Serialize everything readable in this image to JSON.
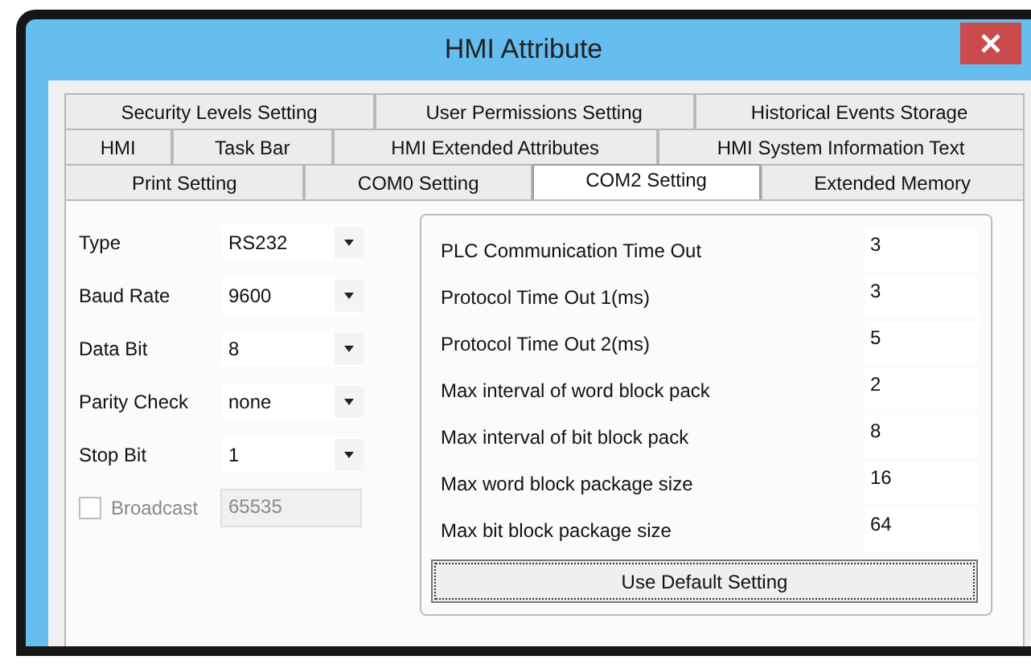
{
  "window": {
    "title": "HMI Attribute"
  },
  "tab_rows": [
    [
      {
        "label": "Security Levels Setting",
        "selected": false
      },
      {
        "label": "User Permissions Setting",
        "selected": false
      },
      {
        "label": "Historical Events Storage",
        "selected": false
      }
    ],
    [
      {
        "label": "HMI",
        "selected": false
      },
      {
        "label": "Task Bar",
        "selected": false
      },
      {
        "label": "HMI Extended Attributes",
        "selected": false
      },
      {
        "label": "HMI System Information Text",
        "selected": false
      }
    ],
    [
      {
        "label": "Print Setting",
        "selected": false
      },
      {
        "label": "COM0 Setting",
        "selected": false
      },
      {
        "label": "COM2 Setting",
        "selected": true
      },
      {
        "label": "Extended Memory",
        "selected": false
      }
    ]
  ],
  "port_settings": [
    {
      "label": "Type",
      "value": "RS232"
    },
    {
      "label": "Baud Rate",
      "value": "9600"
    },
    {
      "label": "Data Bit",
      "value": "8"
    },
    {
      "label": "Parity Check",
      "value": "none"
    },
    {
      "label": "Stop Bit",
      "value": "1"
    }
  ],
  "broadcast": {
    "label": "Broadcast",
    "checked": false,
    "disabled": true,
    "value": "65535"
  },
  "timing": [
    {
      "label": "PLC Communication Time Out",
      "value": "3"
    },
    {
      "label": "Protocol Time Out 1(ms)",
      "value": "3"
    },
    {
      "label": "Protocol Time Out 2(ms)",
      "value": "5"
    },
    {
      "label": "Max interval of word block pack",
      "value": "2"
    },
    {
      "label": "Max interval of bit block pack",
      "value": "8"
    },
    {
      "label": "Max word block package size",
      "value": "16"
    },
    {
      "label": "Max bit block package size",
      "value": "64"
    }
  ],
  "default_button": "Use Default Setting"
}
